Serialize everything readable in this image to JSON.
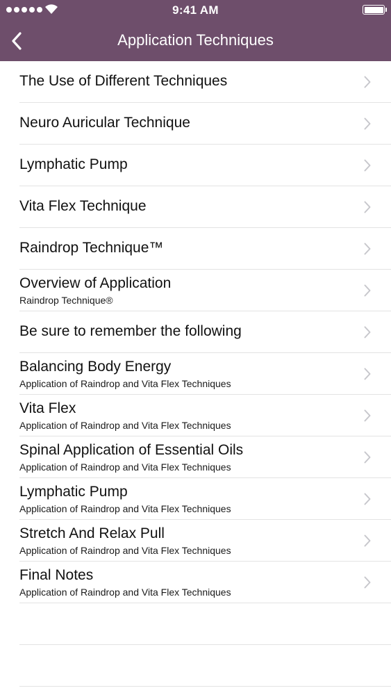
{
  "status_bar": {
    "time": "9:41 AM",
    "signal_icon": "signal-dots-icon",
    "wifi_icon": "wifi-icon",
    "battery_icon": "battery-icon"
  },
  "nav": {
    "title": "Application Techniques",
    "back_icon": "chevron-left-icon"
  },
  "colors": {
    "header_background": "#6e4e6b",
    "header_text": "#ffffff",
    "separator": "#e3e3e3",
    "chevron": "#c7c7cc"
  },
  "list": {
    "items": [
      {
        "title": "The Use of Different Techniques",
        "subtitle": ""
      },
      {
        "title": "Neuro Auricular Technique",
        "subtitle": ""
      },
      {
        "title": "Lymphatic Pump",
        "subtitle": ""
      },
      {
        "title": "Vita Flex Technique",
        "subtitle": ""
      },
      {
        "title": "Raindrop Technique™",
        "subtitle": ""
      },
      {
        "title": "Overview of Application",
        "subtitle": "Raindrop Technique®"
      },
      {
        "title": "Be sure to remember the following",
        "subtitle": ""
      },
      {
        "title": "Balancing Body Energy",
        "subtitle": "Application of Raindrop and Vita Flex Techniques"
      },
      {
        "title": "Vita Flex",
        "subtitle": "Application of Raindrop and Vita Flex Techniques"
      },
      {
        "title": "Spinal Application of Essential Oils",
        "subtitle": "Application of Raindrop and Vita Flex Techniques"
      },
      {
        "title": "Lymphatic Pump",
        "subtitle": "Application of Raindrop and Vita Flex Techniques"
      },
      {
        "title": "Stretch And Relax Pull",
        "subtitle": "Application of Raindrop and Vita Flex Techniques"
      },
      {
        "title": "Final Notes",
        "subtitle": "Application of Raindrop and Vita Flex Techniques"
      }
    ],
    "chevron_icon": "chevron-right-icon"
  }
}
